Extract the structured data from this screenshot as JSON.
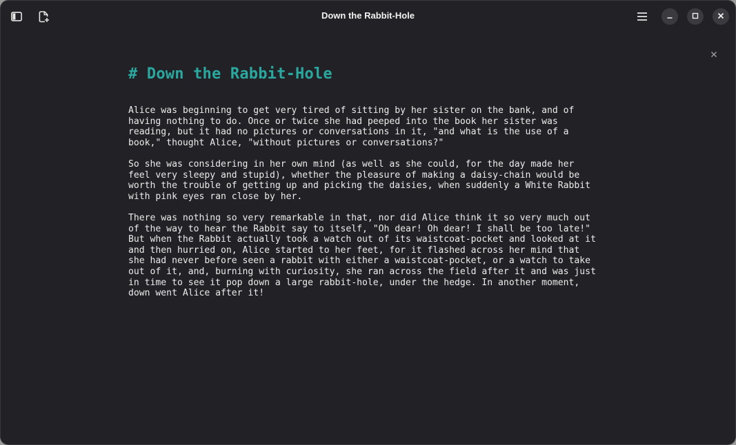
{
  "window": {
    "title": "Down the Rabbit-Hole",
    "accent_color": "#2aa8a0",
    "background_color": "#222226"
  },
  "titlebar": {
    "left_icons": [
      "sidebar-toggle-icon",
      "new-document-icon"
    ],
    "right_icons": [
      "hamburger-menu-icon",
      "minimize-icon",
      "maximize-icon",
      "close-icon"
    ]
  },
  "document": {
    "heading": "# Down the Rabbit-Hole",
    "paragraphs": [
      "Alice was beginning to get very tired of sitting by her sister on the bank, and of\nhaving nothing to do. Once or twice she had peeped into the book her sister was\nreading, but it had no pictures or conversations in it, \"and what is the use of a\nbook,\" thought Alice, \"without pictures or conversations?\"",
      "So she was considering in her own mind (as well as she could, for the day made her\nfeel very sleepy and stupid), whether the pleasure of making a daisy-chain would be\nworth the trouble of getting up and picking the daisies, when suddenly a White Rabbit\nwith pink eyes ran close by her.",
      "There was nothing so very remarkable in that, nor did Alice think it so very much out\nof the way to hear the Rabbit say to itself, \"Oh dear! Oh dear! I shall be too late!\"\nBut when the Rabbit actually took a watch out of its waistcoat-pocket and looked at it\nand then hurried on, Alice started to her feet, for it flashed across her mind that\nshe had never before seen a rabbit with either a waistcoat-pocket, or a watch to take\nout of it, and, burning with curiosity, she ran across the field after it and was just\nin time to see it pop down a large rabbit-hole, under the hedge. In another moment,\ndown went Alice after it!"
    ]
  }
}
